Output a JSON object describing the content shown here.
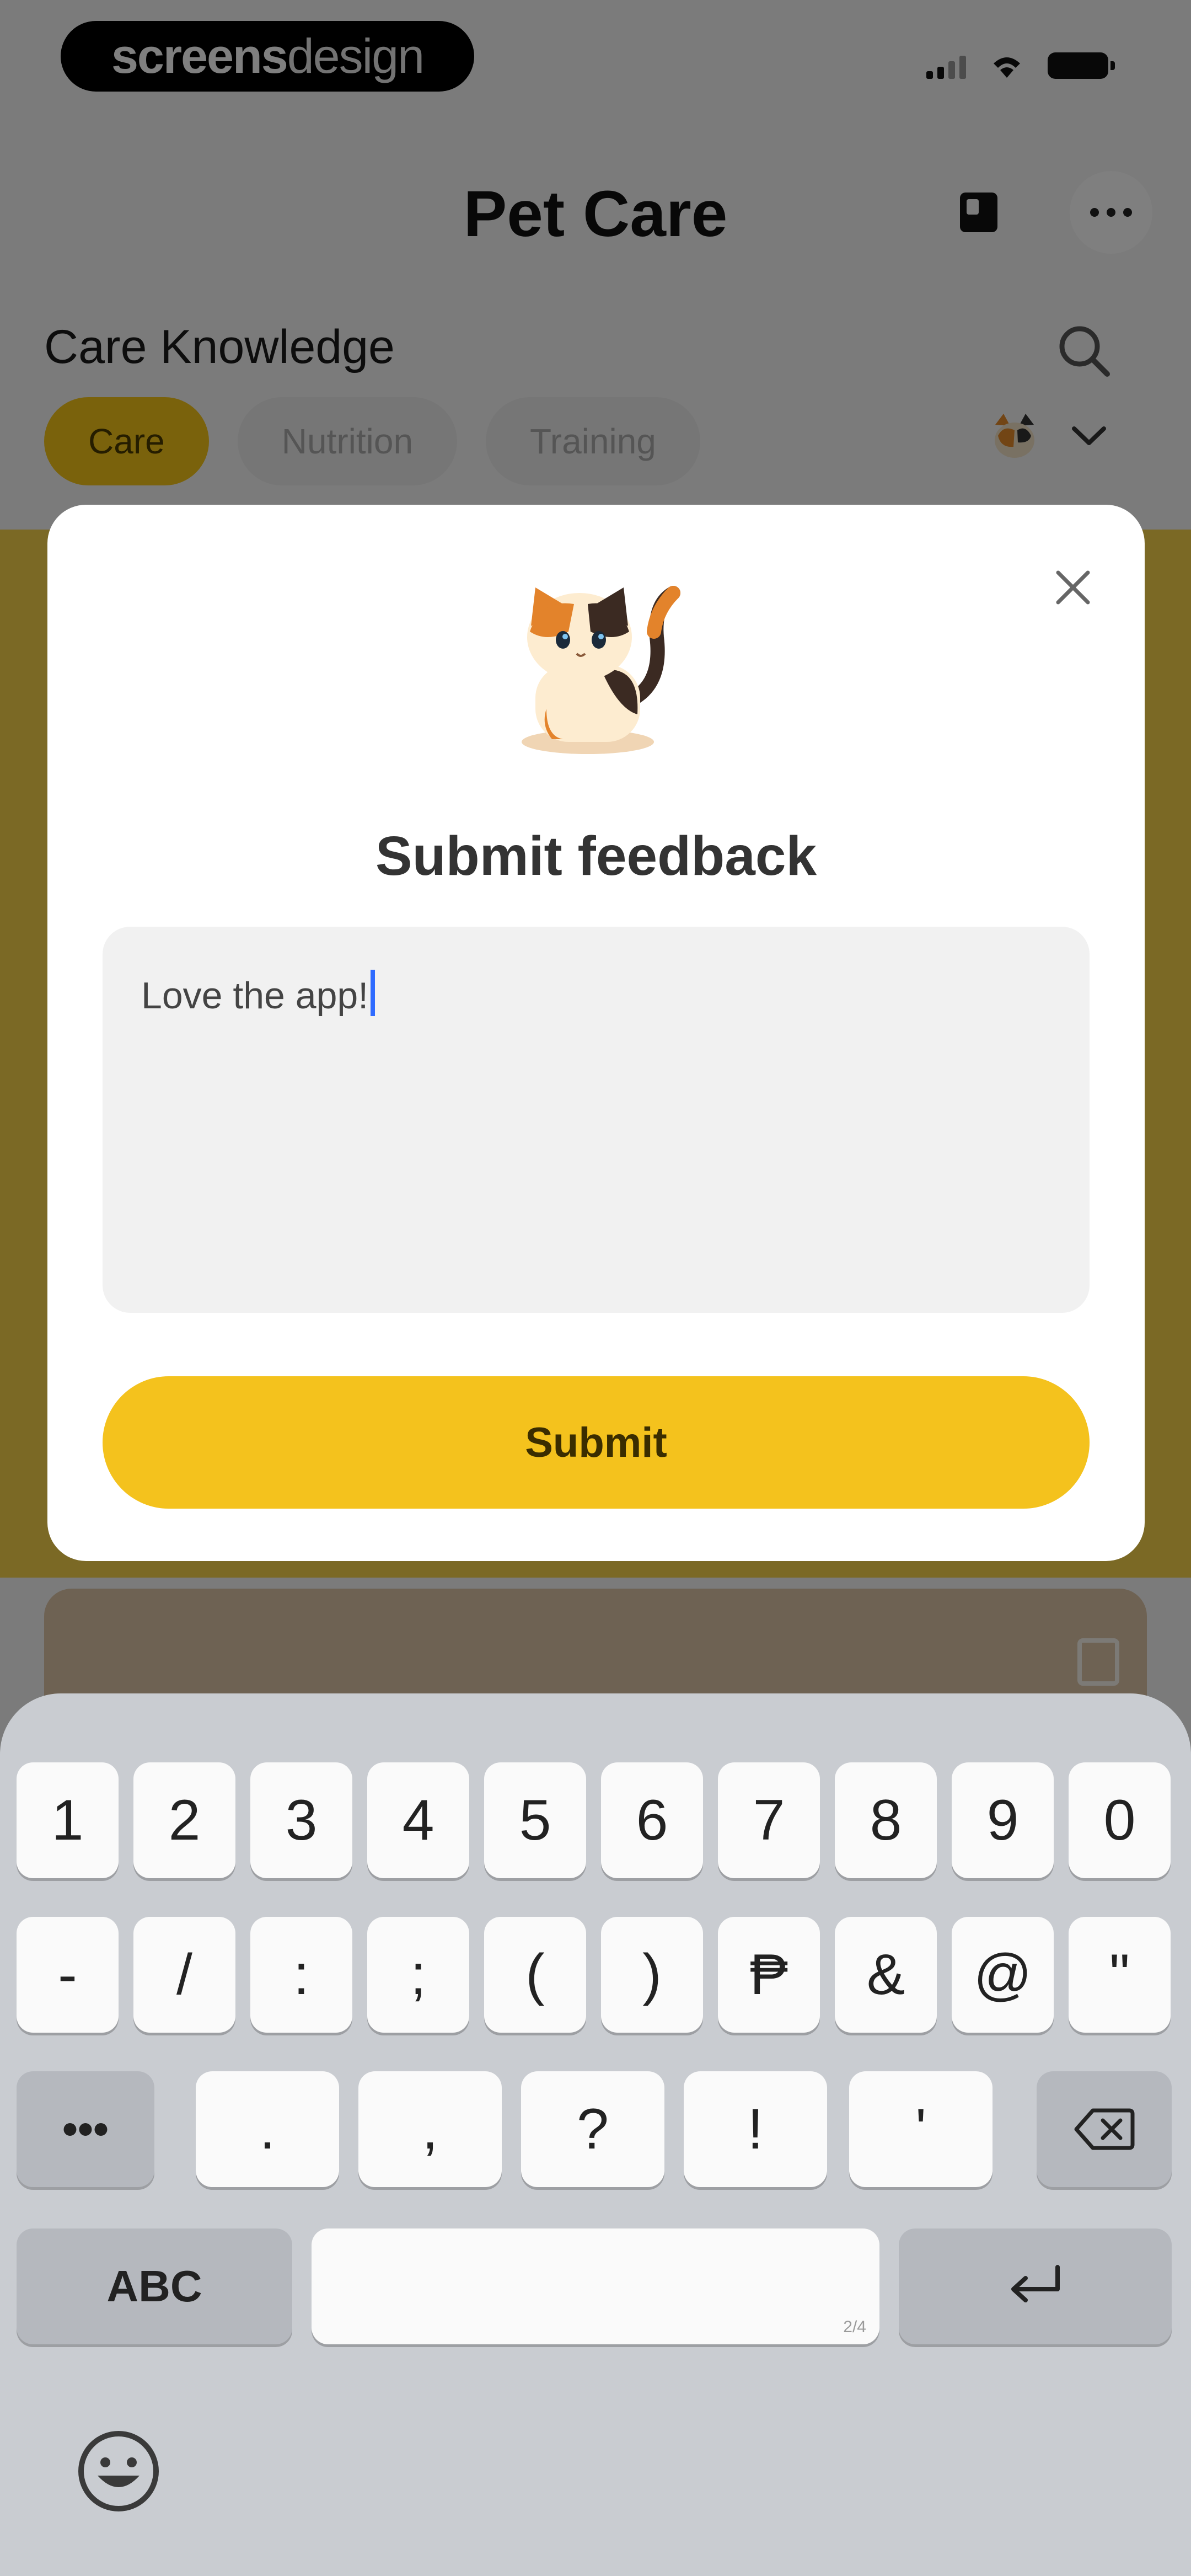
{
  "status_bar": {
    "brand_bold": "screens",
    "brand_light": "design"
  },
  "header": {
    "title": "Pet Care",
    "section_title": "Care Knowledge",
    "tabs": [
      {
        "label": "Care",
        "active": true
      },
      {
        "label": "Nutrition",
        "active": false
      },
      {
        "label": "Training",
        "active": false
      }
    ]
  },
  "modal": {
    "title": "Submit feedback",
    "feedback_value": "Love the app!",
    "submit_label": "Submit"
  },
  "keyboard": {
    "row1": [
      "1",
      "2",
      "3",
      "4",
      "5",
      "6",
      "7",
      "8",
      "9",
      "0"
    ],
    "row2": [
      "-",
      "/",
      ":",
      ";",
      "(",
      ")",
      "₱",
      "&",
      "@",
      "\""
    ],
    "row3": [
      ".",
      ",",
      "?",
      "!",
      "'"
    ],
    "more_key": "•••",
    "abc_key": "ABC",
    "space_hint": "2/4"
  },
  "colors": {
    "accent": "#f4c21d",
    "tab_active": "#f5c518",
    "caret": "#2f6bff"
  },
  "icons": [
    "notebook-icon",
    "more-icon",
    "search-icon",
    "pet-avatar-icon",
    "chevron-down-icon",
    "close-icon",
    "cat-illustration",
    "backspace-icon",
    "return-icon",
    "emoji-icon"
  ]
}
